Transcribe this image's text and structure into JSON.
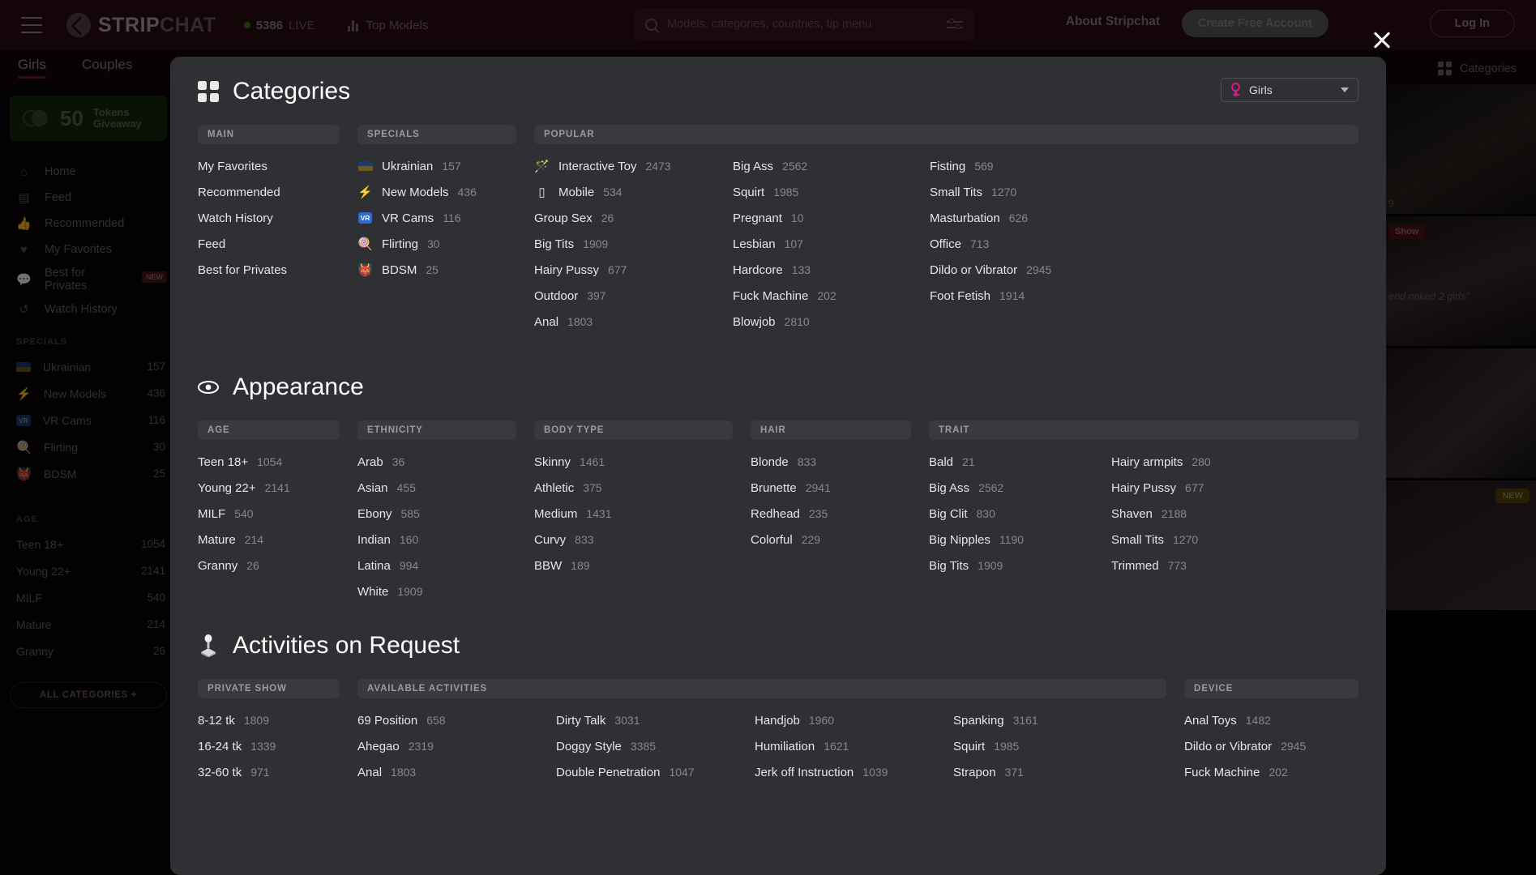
{
  "header": {
    "menu_icon": "hamburger-icon",
    "logo_a": "STRIP",
    "logo_b": "CHAT",
    "live_count": "5386",
    "live_label": "LIVE",
    "top_models": "Top Models",
    "search_placeholder": "Models, categories, countries, tip menu",
    "about": "About Stripchat",
    "create_account": "Create Free Account",
    "login": "Log In",
    "close": "close-icon"
  },
  "gender_tabs": [
    {
      "label": "Girls",
      "active": true
    },
    {
      "label": "Couples",
      "active": false
    }
  ],
  "categories_shortcut": "Categories",
  "sidebar": {
    "giveaway": {
      "amount": "50",
      "line1": "Tokens",
      "line2": "Giveaway"
    },
    "nav": [
      {
        "label": "Home",
        "icon": "home-icon"
      },
      {
        "label": "Feed",
        "icon": "feed-icon"
      },
      {
        "label": "Recommended",
        "icon": "thumbs-up-icon"
      },
      {
        "label": "My Favorites",
        "icon": "heart-icon"
      },
      {
        "label": "Best for Privates",
        "icon": "chat-icon",
        "badge": "NEW"
      },
      {
        "label": "Watch History",
        "icon": "history-icon"
      }
    ],
    "specials_title": "SPECIALS",
    "specials": [
      {
        "label": "Ukrainian",
        "count": "157",
        "icon": "ukraine-flag-icon"
      },
      {
        "label": "New Models",
        "count": "436",
        "icon": "lightning-icon"
      },
      {
        "label": "VR Cams",
        "count": "116",
        "icon": "vr-icon"
      },
      {
        "label": "Flirting",
        "count": "30",
        "icon": "lollipop-icon"
      },
      {
        "label": "BDSM",
        "count": "25",
        "icon": "bdsm-mask-icon"
      }
    ],
    "age_title": "AGE",
    "age": [
      {
        "label": "Teen 18+",
        "count": "1054"
      },
      {
        "label": "Young 22+",
        "count": "2141"
      },
      {
        "label": "MILF",
        "count": "540"
      },
      {
        "label": "Mature",
        "count": "214"
      },
      {
        "label": "Granny",
        "count": "26"
      }
    ],
    "all_categories": "ALL CATEGORIES +"
  },
  "thumbs": [
    {
      "number": "9",
      "tag": "",
      "caption": ""
    },
    {
      "number": "",
      "tag": "Show",
      "caption": "end naked 2 girls\""
    },
    {
      "number": "",
      "tag": "",
      "caption": ""
    },
    {
      "number": "",
      "tag": "NEW",
      "caption": ""
    }
  ],
  "modal": {
    "gender_selector": {
      "value": "Girls",
      "icon": "venus-icon"
    },
    "sections": [
      {
        "title": "Categories",
        "icon": "categories-grid-icon",
        "groups": [
          {
            "title": "MAIN",
            "columns": [
              [
                {
                  "label": "My Favorites",
                  "count": ""
                },
                {
                  "label": "Recommended",
                  "count": ""
                },
                {
                  "label": "Watch History",
                  "count": ""
                },
                {
                  "label": "Feed",
                  "count": ""
                },
                {
                  "label": "Best for Privates",
                  "count": ""
                }
              ]
            ]
          },
          {
            "title": "SPECIALS",
            "columns": [
              [
                {
                  "label": "Ukrainian",
                  "count": "157",
                  "icon": "ukraine-flag-icon"
                },
                {
                  "label": "New Models",
                  "count": "436",
                  "icon": "lightning-icon"
                },
                {
                  "label": "VR Cams",
                  "count": "116",
                  "icon": "vr-icon"
                },
                {
                  "label": "Flirting",
                  "count": "30",
                  "icon": "lollipop-icon"
                },
                {
                  "label": "BDSM",
                  "count": "25",
                  "icon": "bdsm-mask-icon"
                }
              ]
            ]
          },
          {
            "title": "POPULAR",
            "columns": [
              [
                {
                  "label": "Interactive Toy",
                  "count": "2473",
                  "icon": "toy-icon"
                },
                {
                  "label": "Mobile",
                  "count": "534",
                  "icon": "mobile-icon"
                },
                {
                  "label": "Group Sex",
                  "count": "26"
                },
                {
                  "label": "Big Tits",
                  "count": "1909"
                },
                {
                  "label": "Hairy Pussy",
                  "count": "677"
                },
                {
                  "label": "Outdoor",
                  "count": "397"
                },
                {
                  "label": "Anal",
                  "count": "1803"
                }
              ],
              [
                {
                  "label": "Big Ass",
                  "count": "2562"
                },
                {
                  "label": "Squirt",
                  "count": "1985"
                },
                {
                  "label": "Pregnant",
                  "count": "10"
                },
                {
                  "label": "Lesbian",
                  "count": "107"
                },
                {
                  "label": "Hardcore",
                  "count": "133"
                },
                {
                  "label": "Fuck Machine",
                  "count": "202"
                },
                {
                  "label": "Blowjob",
                  "count": "2810"
                }
              ],
              [
                {
                  "label": "Fisting",
                  "count": "569"
                },
                {
                  "label": "Small Tits",
                  "count": "1270"
                },
                {
                  "label": "Masturbation",
                  "count": "626"
                },
                {
                  "label": "Office",
                  "count": "713"
                },
                {
                  "label": "Dildo or Vibrator",
                  "count": "2945"
                },
                {
                  "label": "Foot Fetish",
                  "count": "1914"
                }
              ]
            ]
          }
        ]
      },
      {
        "title": "Appearance",
        "icon": "eye-icon",
        "groups": [
          {
            "title": "AGE",
            "columns": [
              [
                {
                  "label": "Teen 18+",
                  "count": "1054"
                },
                {
                  "label": "Young 22+",
                  "count": "2141"
                },
                {
                  "label": "MILF",
                  "count": "540"
                },
                {
                  "label": "Mature",
                  "count": "214"
                },
                {
                  "label": "Granny",
                  "count": "26"
                }
              ]
            ]
          },
          {
            "title": "ETHNICITY",
            "columns": [
              [
                {
                  "label": "Arab",
                  "count": "36"
                },
                {
                  "label": "Asian",
                  "count": "455"
                },
                {
                  "label": "Ebony",
                  "count": "585"
                },
                {
                  "label": "Indian",
                  "count": "160"
                },
                {
                  "label": "Latina",
                  "count": "994"
                },
                {
                  "label": "White",
                  "count": "1909"
                }
              ]
            ]
          },
          {
            "title": "BODY TYPE",
            "columns": [
              [
                {
                  "label": "Skinny",
                  "count": "1461"
                },
                {
                  "label": "Athletic",
                  "count": "375"
                },
                {
                  "label": "Medium",
                  "count": "1431"
                },
                {
                  "label": "Curvy",
                  "count": "833"
                },
                {
                  "label": "BBW",
                  "count": "189"
                }
              ]
            ]
          },
          {
            "title": "HAIR",
            "columns": [
              [
                {
                  "label": "Blonde",
                  "count": "833"
                },
                {
                  "label": "Brunette",
                  "count": "2941"
                },
                {
                  "label": "Redhead",
                  "count": "235"
                },
                {
                  "label": "Colorful",
                  "count": "229"
                }
              ]
            ]
          },
          {
            "title": "TRAIT",
            "columns": [
              [
                {
                  "label": "Bald",
                  "count": "21"
                },
                {
                  "label": "Big Ass",
                  "count": "2562"
                },
                {
                  "label": "Big Clit",
                  "count": "830"
                },
                {
                  "label": "Big Nipples",
                  "count": "1190"
                },
                {
                  "label": "Big Tits",
                  "count": "1909"
                }
              ],
              [
                {
                  "label": "Hairy armpits",
                  "count": "280"
                },
                {
                  "label": "Hairy Pussy",
                  "count": "677"
                },
                {
                  "label": "Shaven",
                  "count": "2188"
                },
                {
                  "label": "Small Tits",
                  "count": "1270"
                },
                {
                  "label": "Trimmed",
                  "count": "773"
                }
              ]
            ]
          }
        ]
      },
      {
        "title": "Activities on Request",
        "icon": "joystick-icon",
        "groups": [
          {
            "title": "PRIVATE SHOW",
            "columns": [
              [
                {
                  "label": "8-12 tk",
                  "count": "1809"
                },
                {
                  "label": "16-24 tk",
                  "count": "1339"
                },
                {
                  "label": "32-60 tk",
                  "count": "971"
                }
              ]
            ]
          },
          {
            "title": "AVAILABLE ACTIVITIES",
            "columns": [
              [
                {
                  "label": "69 Position",
                  "count": "658"
                },
                {
                  "label": "Ahegao",
                  "count": "2319"
                },
                {
                  "label": "Anal",
                  "count": "1803"
                }
              ],
              [
                {
                  "label": "Dirty Talk",
                  "count": "3031"
                },
                {
                  "label": "Doggy Style",
                  "count": "3385"
                },
                {
                  "label": "Double Penetration",
                  "count": "1047"
                }
              ],
              [
                {
                  "label": "Handjob",
                  "count": "1960"
                },
                {
                  "label": "Humiliation",
                  "count": "1621"
                },
                {
                  "label": "Jerk off Instruction",
                  "count": "1039"
                }
              ],
              [
                {
                  "label": "Spanking",
                  "count": "3161"
                },
                {
                  "label": "Squirt",
                  "count": "1985"
                },
                {
                  "label": "Strapon",
                  "count": "371"
                }
              ]
            ]
          },
          {
            "title": "DEVICE",
            "columns": [
              [
                {
                  "label": "Anal Toys",
                  "count": "1482"
                },
                {
                  "label": "Dildo or Vibrator",
                  "count": "2945"
                },
                {
                  "label": "Fuck Machine",
                  "count": "202"
                }
              ]
            ]
          }
        ]
      }
    ]
  }
}
